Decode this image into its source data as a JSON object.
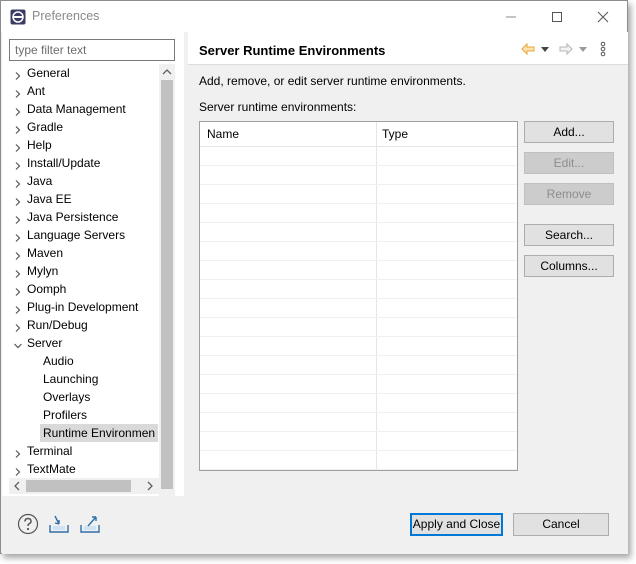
{
  "window": {
    "title": "Preferences",
    "app_icon": "eclipse-icon"
  },
  "sidebar": {
    "filter_placeholder": "type filter text",
    "filter_value": "",
    "items": [
      {
        "label": "General",
        "level": 0,
        "expanded": false
      },
      {
        "label": "Ant",
        "level": 0,
        "expanded": false
      },
      {
        "label": "Data Management",
        "level": 0,
        "expanded": false
      },
      {
        "label": "Gradle",
        "level": 0,
        "expanded": false
      },
      {
        "label": "Help",
        "level": 0,
        "expanded": false
      },
      {
        "label": "Install/Update",
        "level": 0,
        "expanded": false
      },
      {
        "label": "Java",
        "level": 0,
        "expanded": false
      },
      {
        "label": "Java EE",
        "level": 0,
        "expanded": false
      },
      {
        "label": "Java Persistence",
        "level": 0,
        "expanded": false
      },
      {
        "label": "Language Servers",
        "level": 0,
        "expanded": false
      },
      {
        "label": "Maven",
        "level": 0,
        "expanded": false
      },
      {
        "label": "Mylyn",
        "level": 0,
        "expanded": false
      },
      {
        "label": "Oomph",
        "level": 0,
        "expanded": false
      },
      {
        "label": "Plug-in Development",
        "level": 0,
        "expanded": false
      },
      {
        "label": "Run/Debug",
        "level": 0,
        "expanded": false
      },
      {
        "label": "Server",
        "level": 0,
        "expanded": true
      },
      {
        "label": "Audio",
        "level": 1
      },
      {
        "label": "Launching",
        "level": 1
      },
      {
        "label": "Overlays",
        "level": 1
      },
      {
        "label": "Profilers",
        "level": 1
      },
      {
        "label": "Runtime Environmen",
        "level": 1,
        "selected": true
      },
      {
        "label": "Terminal",
        "level": 0,
        "expanded": false
      },
      {
        "label": "TextMate",
        "level": 0,
        "expanded": false
      }
    ]
  },
  "page": {
    "title": "Server Runtime Environments",
    "description": "Add, remove, or edit server runtime environments.",
    "list_label": "Server runtime environments:",
    "table": {
      "columns": [
        "Name",
        "Type"
      ],
      "rows": []
    },
    "buttons": {
      "add": "Add...",
      "edit": "Edit...",
      "remove": "Remove",
      "search": "Search...",
      "columns": "Columns..."
    }
  },
  "footer": {
    "apply_close": "Apply and Close",
    "cancel": "Cancel"
  },
  "colors": {
    "accent": "#0078d7",
    "back_arrow": "#e8a33b",
    "footer_icon": "#2f6fa8"
  }
}
